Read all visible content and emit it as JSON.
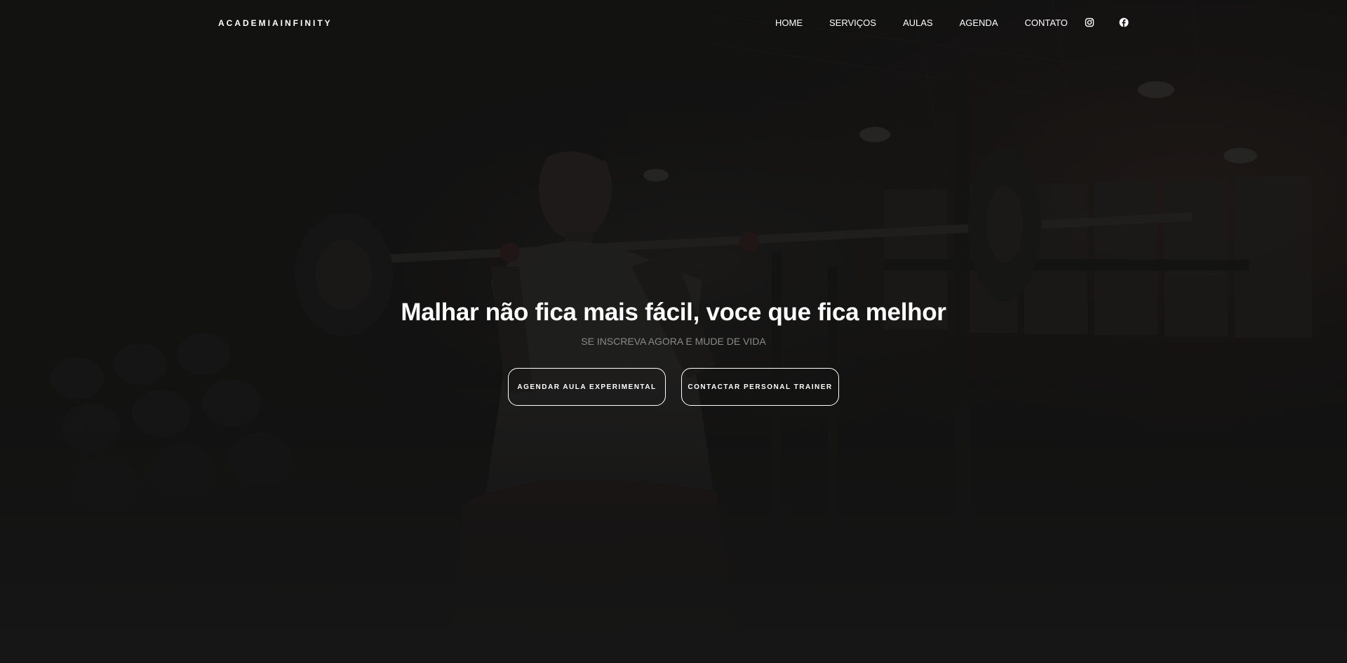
{
  "navbar": {
    "brand": "ACADEMIAINFINITY",
    "links": [
      "HOME",
      "SERVIÇOS",
      "AULAS",
      "AGENDA",
      "CONTATO"
    ],
    "social": [
      "instagram-icon",
      "facebook-icon"
    ]
  },
  "hero": {
    "headline": "Malhar não fica mais fácil, voce que fica melhor",
    "subheadline": "SE INSCREVA AGORA E MUDE DE VIDA",
    "buttons": [
      "AGENDAR AULA EXPERIMENTAL",
      "CONTACTAR PERSONAL TRAINER"
    ]
  },
  "colors": {
    "background": "#141414",
    "text": "#ffffff",
    "muted": "#8a8a8a"
  }
}
